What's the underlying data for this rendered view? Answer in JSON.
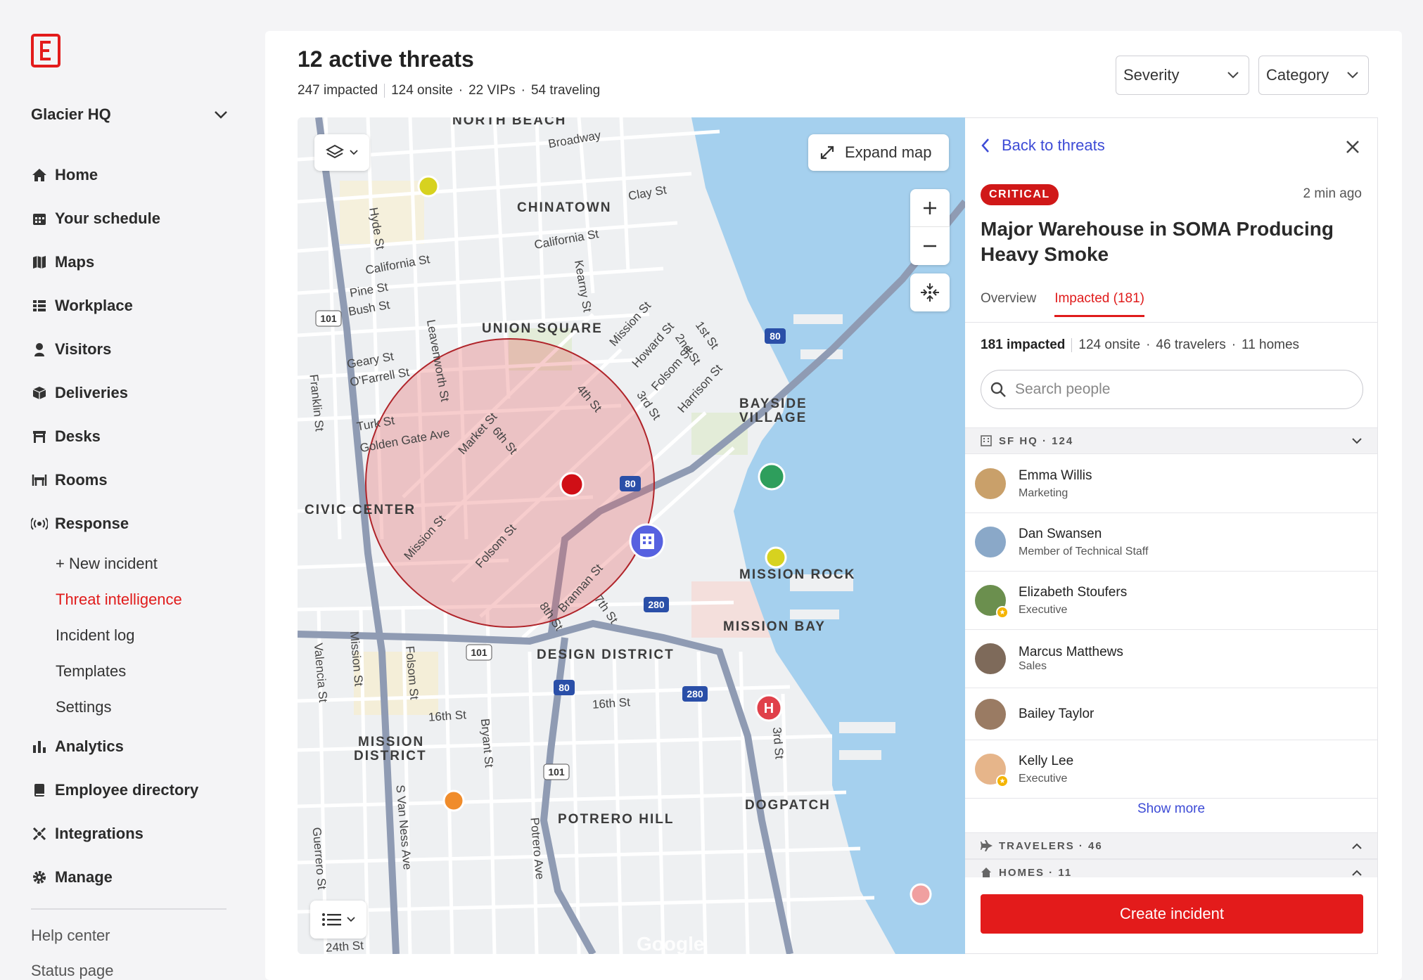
{
  "app": {
    "org": "Glacier HQ",
    "brand_color": "#e31b1b"
  },
  "sidebar": {
    "items": [
      {
        "label": "Home",
        "icon": "home-icon"
      },
      {
        "label": "Your schedule",
        "icon": "calendar-icon"
      },
      {
        "label": "Maps",
        "icon": "map-icon"
      },
      {
        "label": "Workplace",
        "icon": "workplace-icon"
      },
      {
        "label": "Visitors",
        "icon": "visitor-icon"
      },
      {
        "label": "Deliveries",
        "icon": "package-icon"
      },
      {
        "label": "Desks",
        "icon": "desk-icon"
      },
      {
        "label": "Rooms",
        "icon": "room-icon"
      },
      {
        "label": "Response",
        "icon": "broadcast-icon"
      }
    ],
    "response_sub": [
      "+ New incident",
      "Threat intelligence",
      "Incident log",
      "Templates",
      "Settings"
    ],
    "items_after": [
      {
        "label": "Analytics",
        "icon": "bar-chart-icon"
      },
      {
        "label": "Employee directory",
        "icon": "book-icon"
      },
      {
        "label": "Integrations",
        "icon": "integrations-icon"
      },
      {
        "label": "Manage",
        "icon": "gear-icon"
      }
    ],
    "footer": [
      "Help center",
      "Status page"
    ]
  },
  "header": {
    "title": "12 active threats",
    "impacted": "247 impacted",
    "onsite": "124 onsite",
    "vips": "22 VIPs",
    "traveling": "54 traveling",
    "filters": [
      "Severity",
      "Category"
    ]
  },
  "map": {
    "expand_label": "Expand map",
    "neighborhoods": [
      "NORTH BEACH",
      "CHINATOWN",
      "UNION SQUARE",
      "BAYSIDE",
      "VILLAGE",
      "CIVIC CENTER",
      "MISSION ROCK",
      "MISSION BAY",
      "DESIGN DISTRICT",
      "MISSION",
      "DISTRICT",
      "POTRERO HILL",
      "DOGPATCH"
    ],
    "streets": [
      "Broadway",
      "Clay St",
      "California St",
      "California St",
      "Pine St",
      "Bush St",
      "Hyde St",
      "Kearny St",
      "Leavenworth St",
      "Geary St",
      "O'Farrell St",
      "Turk St",
      "Golden Gate Ave",
      "Franklin St",
      "Market St",
      "6th St",
      "4th St",
      "3rd St",
      "Mission St",
      "Howard St",
      "Folsom St",
      "Harrison St",
      "1st St",
      "2nd St",
      "Folsom St",
      "Mission St",
      "Brannan St",
      "7th St",
      "8th St",
      "16th St",
      "16th St",
      "Valencia St",
      "Mission St",
      "Folsom St",
      "Bryant St",
      "S Van Ness Ave",
      "Potrero Ave",
      "3rd St",
      "Guerrero St",
      "24th St",
      "101",
      "101",
      "101",
      "80",
      "80",
      "80",
      "280",
      "280"
    ],
    "attribution": "Google"
  },
  "panel": {
    "back_label": "Back to threats",
    "severity": "CRITICAL",
    "time": "2 min ago",
    "title": "Major Warehouse in SOMA Producing Heavy Smoke",
    "tabs": [
      "Overview",
      "Impacted (181)"
    ],
    "impacted": "181 impacted",
    "onsite": "124 onsite",
    "travelers": "46 travelers",
    "homes": "11 homes",
    "search_placeholder": "Search people",
    "group_office": "SF HQ · 124",
    "people": [
      {
        "name": "Emma Willis",
        "role": "Marketing"
      },
      {
        "name": "Dan Swansen",
        "role": "Member of Technical Staff"
      },
      {
        "name": "Elizabeth Stoufers",
        "role": "Executive"
      },
      {
        "name": "Marcus Matthews",
        "role": "Sales"
      },
      {
        "name": "Bailey Taylor",
        "role": ""
      },
      {
        "name": "Kelly Lee",
        "role": "Executive"
      }
    ],
    "show_more": "Show more",
    "group_travelers": "TRAVELERS · 46",
    "group_homes": "HOMES · 11",
    "create_label": "Create incident"
  }
}
